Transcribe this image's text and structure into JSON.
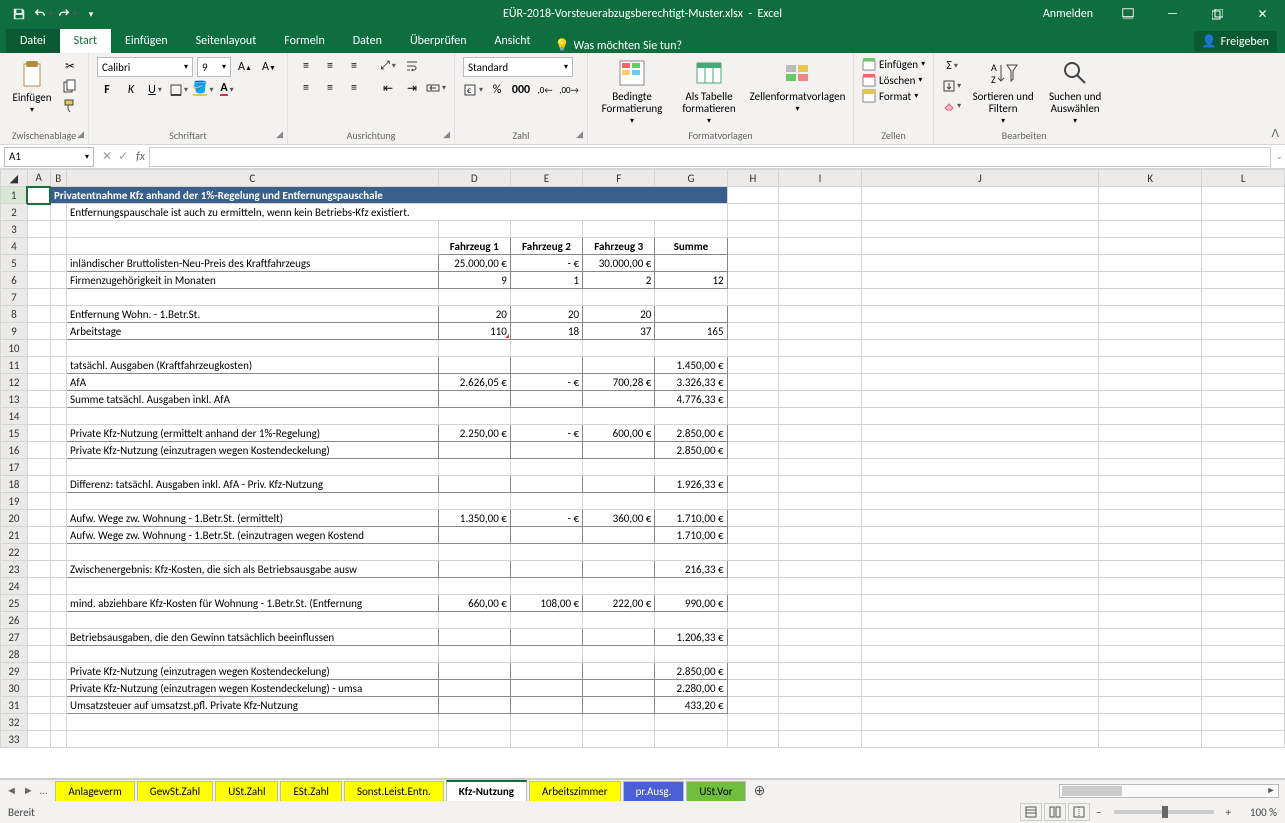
{
  "app": {
    "title_doc": "EÜR-2018-Vorsteuerabzugsberechtigt-Muster.xlsx",
    "title_app": "Excel",
    "signin": "Anmelden"
  },
  "tabs": {
    "file": "Datei",
    "start": "Start",
    "einfuegen": "Einfügen",
    "seitenlayout": "Seitenlayout",
    "formeln": "Formeln",
    "daten": "Daten",
    "ueberpruefen": "Überprüfen",
    "ansicht": "Ansicht",
    "tellme": "Was möchten Sie tun?",
    "freigeben": "Freigeben"
  },
  "ribbon": {
    "clipboard": {
      "paste": "Einfügen",
      "label": "Zwischenablage"
    },
    "font": {
      "name": "Calibri",
      "size": "9",
      "label": "Schriftart"
    },
    "align": {
      "label": "Ausrichtung"
    },
    "number": {
      "format": "Standard",
      "label": "Zahl"
    },
    "styles": {
      "cond": "Bedingte Formatierung",
      "table": "Als Tabelle formatieren",
      "cell": "Zellenformatvorlagen",
      "label": "Formatvorlagen"
    },
    "cells": {
      "insert": "Einfügen",
      "delete": "Löschen",
      "format": "Format",
      "label": "Zellen"
    },
    "editing": {
      "sort": "Sortieren und Filtern",
      "find": "Suchen und Auswählen",
      "label": "Bearbeiten"
    }
  },
  "fbar": {
    "namebox": "A1"
  },
  "sheet": {
    "cols": [
      "A",
      "B",
      "C",
      "D",
      "E",
      "F",
      "G",
      "H",
      "I",
      "J",
      "K",
      "L"
    ],
    "title": "Privatentnahme Kfz anhand der 1%-Regelung und Entfernungspauschale",
    "subtitle": "Entfernungspauschale ist auch zu ermitteln, wenn kein Betriebs-Kfz existiert.",
    "hdr": {
      "d": "Fahrzeug 1",
      "e": "Fahrzeug 2",
      "f": "Fahrzeug 3",
      "g": "Summe"
    },
    "r5": {
      "c": "inländischer Bruttolisten-Neu-Preis des Kraftfahrzeugs",
      "d": "25.000,00 €",
      "e": "-   €",
      "f": "30.000,00 €",
      "g": ""
    },
    "r6": {
      "c": "Firmenzugehörigkeit in Monaten",
      "d": "9",
      "e": "1",
      "f": "2",
      "g": "12"
    },
    "r8": {
      "c": "Entfernung Wohn. - 1.Betr.St.",
      "d": "20",
      "e": "20",
      "f": "20",
      "g": ""
    },
    "r9": {
      "c": "Arbeitstage",
      "d": "110",
      "e": "18",
      "f": "37",
      "g": "165"
    },
    "r11": {
      "c": "tatsächl. Ausgaben (Kraftfahrzeugkosten)",
      "g": "1.450,00 €"
    },
    "r12": {
      "c": "AfA",
      "d": "2.626,05 €",
      "e": "-   €",
      "f": "700,28 €",
      "g": "3.326,33 €"
    },
    "r13": {
      "c": "Summe tatsächl. Ausgaben inkl. AfA",
      "g": "4.776,33 €"
    },
    "r15": {
      "c": "Private Kfz-Nutzung (ermittelt anhand der 1%-Regelung)",
      "d": "2.250,00 €",
      "e": "-   €",
      "f": "600,00 €",
      "g": "2.850,00 €"
    },
    "r16": {
      "c": "Private Kfz-Nutzung (einzutragen wegen Kostendeckelung)",
      "g": "2.850,00 €"
    },
    "r18": {
      "c": "Differenz: tatsächl. Ausgaben inkl. AfA - Priv. Kfz-Nutzung",
      "g": "1.926,33 €"
    },
    "r20": {
      "c": "Aufw. Wege zw. Wohnung - 1.Betr.St. (ermittelt)",
      "d": "1.350,00 €",
      "e": "-   €",
      "f": "360,00 €",
      "g": "1.710,00 €"
    },
    "r21": {
      "c": "Aufw. Wege zw. Wohnung - 1.Betr.St. (einzutragen wegen Kostend",
      "g": "1.710,00 €"
    },
    "r23": {
      "c": "Zwischenergebnis: Kfz-Kosten, die sich als Betriebsausgabe ausw",
      "g": "216,33 €"
    },
    "r25": {
      "c": "mind. abziehbare Kfz-Kosten für Wohnung - 1.Betr.St. (Entfernung",
      "d": "660,00 €",
      "e": "108,00 €",
      "f": "222,00 €",
      "g": "990,00 €"
    },
    "r27": {
      "c": "Betriebsausgaben, die den Gewinn tatsächlich beeinflussen",
      "g": "1.206,33 €"
    },
    "r29": {
      "c": "Private Kfz-Nutzung (einzutragen wegen Kostendeckelung)",
      "g": "2.850,00 €"
    },
    "r30": {
      "c": "Private Kfz-Nutzung (einzutragen wegen Kostendeckelung) - umsa",
      "g": "2.280,00 €"
    },
    "r31": {
      "c": "Umsatzsteuer auf umsatzst.pfl. Private Kfz-Nutzung",
      "g": "433,20 €"
    }
  },
  "sheettabs": {
    "t1": "Anlageverm",
    "t2": "GewSt.Zahl",
    "t3": "USt.Zahl",
    "t4": "ESt.Zahl",
    "t5": "Sonst.Leist.Entn.",
    "active": "Kfz-Nutzung",
    "t7": "Arbeitszimmer",
    "t8": "pr.Ausg.",
    "t9": "USt.Vor"
  },
  "status": {
    "ready": "Bereit",
    "zoom": "100 %"
  }
}
